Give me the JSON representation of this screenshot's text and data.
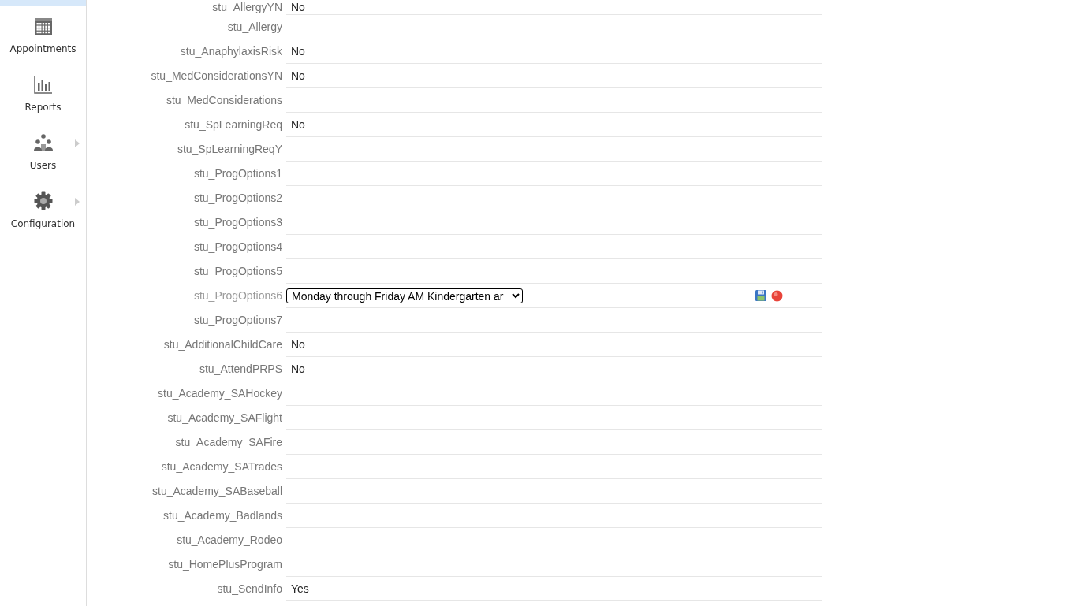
{
  "sidebar": {
    "items": [
      {
        "label": "Appointments",
        "has_submenu": false
      },
      {
        "label": "Reports",
        "has_submenu": false
      },
      {
        "label": "Users",
        "has_submenu": true
      },
      {
        "label": "Configuration",
        "has_submenu": true
      }
    ]
  },
  "fields": [
    {
      "label": "stu_AllergyYN",
      "kind": "text",
      "value": "No"
    },
    {
      "label": "stu_Allergy",
      "kind": "text"
    },
    {
      "label": "stu_AnaphylaxisRisk",
      "kind": "text",
      "value": "No"
    },
    {
      "label": "stu_MedConsiderationsYN",
      "kind": "text",
      "value": "No"
    },
    {
      "label": "stu_MedConsiderations",
      "kind": "text"
    },
    {
      "label": "stu_SpLearningReq",
      "kind": "text",
      "value": "No"
    },
    {
      "label": "stu_SpLearningReqY",
      "kind": "text"
    },
    {
      "label": "stu_ProgOptions1",
      "kind": "text"
    },
    {
      "label": "stu_ProgOptions2",
      "kind": "text"
    },
    {
      "label": "stu_ProgOptions3",
      "kind": "text"
    },
    {
      "label": "stu_ProgOptions4",
      "kind": "text"
    },
    {
      "label": "stu_ProgOptions5",
      "kind": "text"
    },
    {
      "label": "stu_ProgOptions6",
      "kind": "select",
      "value": "Monday through Friday AM Kindergarten ar"
    },
    {
      "label": "stu_ProgOptions7",
      "kind": "text"
    },
    {
      "label": "stu_AdditionalChildCare",
      "kind": "text",
      "value": "No"
    },
    {
      "label": "stu_AttendPRPS",
      "kind": "text",
      "value": "No"
    },
    {
      "label": "stu_Academy_SAHockey",
      "kind": "text"
    },
    {
      "label": "stu_Academy_SAFlight",
      "kind": "text"
    },
    {
      "label": "stu_Academy_SAFire",
      "kind": "text"
    },
    {
      "label": "stu_Academy_SATrades",
      "kind": "text"
    },
    {
      "label": "stu_Academy_SABaseball",
      "kind": "text"
    },
    {
      "label": "stu_Academy_Badlands",
      "kind": "text"
    },
    {
      "label": "stu_Academy_Rodeo",
      "kind": "text"
    },
    {
      "label": "stu_HomePlusProgram",
      "kind": "text"
    },
    {
      "label": "stu_SendInfo",
      "kind": "text",
      "value": "Yes"
    }
  ]
}
